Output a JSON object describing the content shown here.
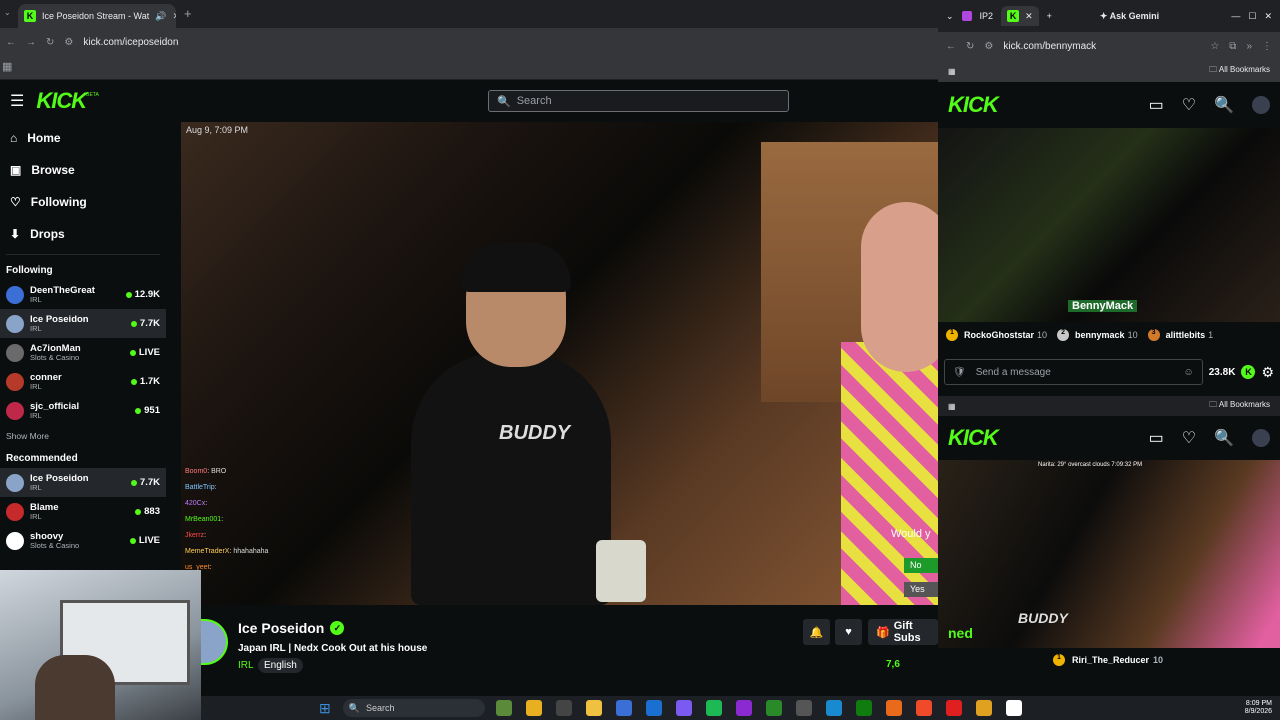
{
  "left_browser": {
    "tab_title": "Ice Poseidon Stream - Wat",
    "url": "kick.com/iceposeidon"
  },
  "kick": {
    "logo": "KICK",
    "logo_tag": "BETA",
    "search_placeholder": "Search",
    "nav": [
      "Home",
      "Browse",
      "Following",
      "Drops"
    ],
    "following_header": "Following",
    "following": [
      {
        "name": "DeenTheGreat",
        "category": "IRL",
        "viewers": "12.9K",
        "color": "#3b6fd6"
      },
      {
        "name": "Ice Poseidon",
        "category": "IRL",
        "viewers": "7.7K",
        "color": "#8aa3c9"
      },
      {
        "name": "Ac7ionMan",
        "category": "Slots & Casino",
        "viewers": "LIVE",
        "color": "#6a6a6a"
      },
      {
        "name": "conner",
        "category": "IRL",
        "viewers": "1.7K",
        "color": "#b53a2a"
      },
      {
        "name": "sjc_official",
        "category": "IRL",
        "viewers": "951",
        "color": "#c0284a"
      }
    ],
    "show_more": "Show More",
    "recommended_header": "Recommended",
    "recommended": [
      {
        "name": "Ice Poseidon",
        "category": "IRL",
        "viewers": "7.7K",
        "color": "#8aa3c9"
      },
      {
        "name": "Blame",
        "category": "IRL",
        "viewers": "883",
        "color": "#c72a2a"
      },
      {
        "name": "shoovy",
        "category": "Slots & Casino",
        "viewers": "LIVE",
        "color": "#ffffff"
      }
    ]
  },
  "video": {
    "timestamp": "Aug 9, 7:09 PM",
    "shirt_text": "BUDDY",
    "chat_overlay": [
      {
        "user": "Boom0",
        "msg": "BRO"
      },
      {
        "user": "BattleTrip",
        "msg": ""
      },
      {
        "user": "420Cx",
        "msg": ""
      },
      {
        "user": "MrBean001",
        "msg": ""
      },
      {
        "user": "Jkerrz",
        "msg": ""
      },
      {
        "user": "MemeTraderX",
        "msg": "hhahahaha"
      },
      {
        "user": "us_yeet",
        "msg": ""
      }
    ],
    "poll_question": "Would y",
    "poll_no": "No",
    "poll_yes": "Yes"
  },
  "stream_info": {
    "streamer": "Ice Poseidon",
    "title": "Japan IRL | Nedx Cook Out at his house",
    "category": "IRL",
    "language": "English",
    "gift_label": "Gift Subs",
    "viewers": "7,6"
  },
  "right_window": {
    "tab1": "IP2",
    "ask_gemini": "Ask Gemini",
    "url": "kick.com/bennymack",
    "all_bookmarks": "All Bookmarks",
    "overlay_name": "BennyMack",
    "gifters": [
      {
        "rank": "1",
        "name": "RockoGhoststar",
        "count": "10",
        "color": "#f0b400"
      },
      {
        "rank": "2",
        "name": "bennymack",
        "count": "10",
        "color": "#c8c8c8"
      },
      {
        "rank": "3",
        "name": "alittlebits",
        "count": "1",
        "color": "#d17a2a"
      }
    ],
    "chat_placeholder": "Send a message",
    "viewers": "23.8K",
    "all_bookmarks_2": "All Bookmarks",
    "caption_2": "Narita: 29° overcast clouds 7:09:32 PM",
    "gifter_2": {
      "rank": "1",
      "name": "Riri_The_Reducer",
      "count": "10"
    },
    "neds_label": "ned"
  },
  "taskbar": {
    "search": "Search",
    "time": "8:09 PM",
    "date": "8/9/2026"
  }
}
